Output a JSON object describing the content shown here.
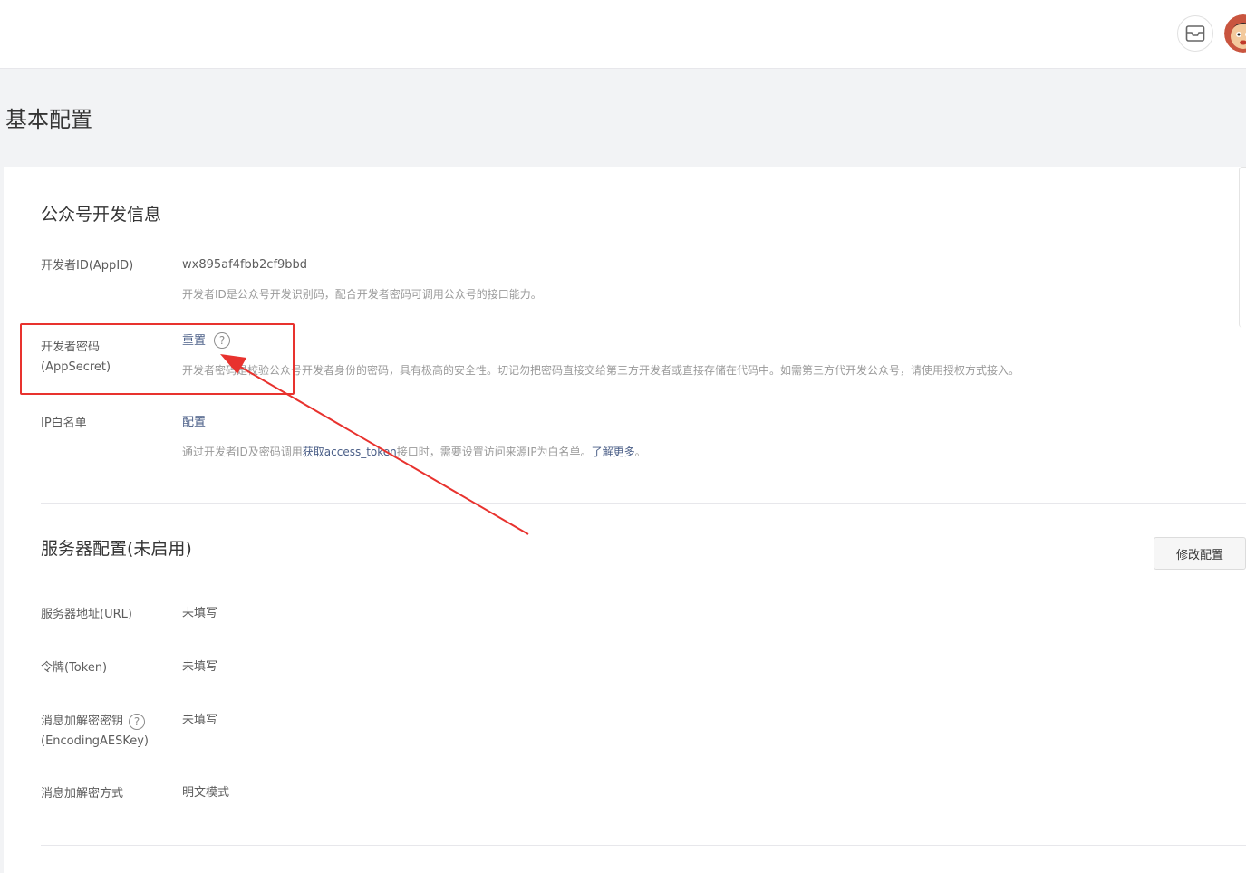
{
  "header": {
    "mail_icon": "mail-icon",
    "avatar_icon": "avatar"
  },
  "page": {
    "title": "基本配置"
  },
  "dev_info": {
    "title": "公众号开发信息",
    "appid": {
      "label": "开发者ID(AppID)",
      "value": "wx895af4fbb2cf9bbd",
      "desc": "开发者ID是公众号开发识别码，配合开发者密码可调用公众号的接口能力。"
    },
    "appsecret": {
      "label_line1": "开发者密码",
      "label_line2": "(AppSecret)",
      "action": "重置",
      "help": "?",
      "desc": "开发者密码是校验公众号开发者身份的密码，具有极高的安全性。切记勿把密码直接交给第三方开发者或直接存储在代码中。如需第三方代开发公众号，请使用授权方式接入。"
    },
    "ip_whitelist": {
      "label": "IP白名单",
      "action": "配置",
      "desc_prefix": "通过开发者ID及密码调用",
      "desc_link1": "获取access_token",
      "desc_middle": "接口时，需要设置访问来源IP为白名单。",
      "desc_link2": "了解更多",
      "desc_suffix": "。"
    }
  },
  "server_config": {
    "title": "服务器配置(未启用)",
    "modify_button": "修改配置",
    "url": {
      "label": "服务器地址(URL)",
      "value": "未填写"
    },
    "token": {
      "label": "令牌(Token)",
      "value": "未填写"
    },
    "aeskey": {
      "label_line1": "消息加解密密钥",
      "label_line2": "(EncodingAESKey)",
      "help": "?",
      "value": "未填写"
    },
    "encrypt_mode": {
      "label": "消息加解密方式",
      "value": "明文模式"
    }
  },
  "annotation": {
    "color": "#e8322e"
  }
}
